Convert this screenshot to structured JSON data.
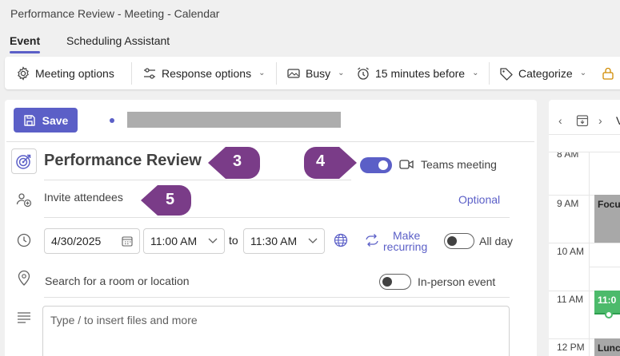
{
  "window": {
    "title": "Performance Review - Meeting - Calendar"
  },
  "tabs": [
    {
      "label": "Event",
      "active": true
    },
    {
      "label": "Scheduling Assistant",
      "active": false
    }
  ],
  "ribbon": {
    "meeting_options": "Meeting options",
    "response_options": "Response options",
    "busy": "Busy",
    "reminder": "15 minutes before",
    "categorize": "Categorize"
  },
  "form": {
    "save_label": "Save",
    "title": "Performance Review",
    "teams_label": "Teams meeting",
    "teams_enabled": true,
    "invite_placeholder": "Invite attendees",
    "optional_label": "Optional",
    "date": "4/30/2025",
    "start_time": "11:00 AM",
    "to_label": "to",
    "end_time": "11:30 AM",
    "make_recurring_line1": "Make",
    "make_recurring_line2": "recurring",
    "all_day_label": "All day",
    "all_day_enabled": false,
    "location_placeholder": "Search for a room or location",
    "in_person_label": "In-person event",
    "in_person_enabled": false,
    "body_placeholder": "Type / to insert files and more"
  },
  "callouts": {
    "c3": "3",
    "c4": "4",
    "c5": "5"
  },
  "calendar": {
    "times": [
      "8 AM",
      "9 AM",
      "10 AM",
      "11 AM",
      "12 PM"
    ],
    "events": [
      {
        "label": "Focu",
        "color": "#a8a8a8"
      },
      {
        "label": "11:0",
        "color": "#4cba6b"
      },
      {
        "label": "Lunc",
        "color": "#a8a8a8"
      }
    ],
    "nav_partial": "V"
  },
  "colors": {
    "accent": "#5b5fc7",
    "callout": "#7a3c88"
  }
}
